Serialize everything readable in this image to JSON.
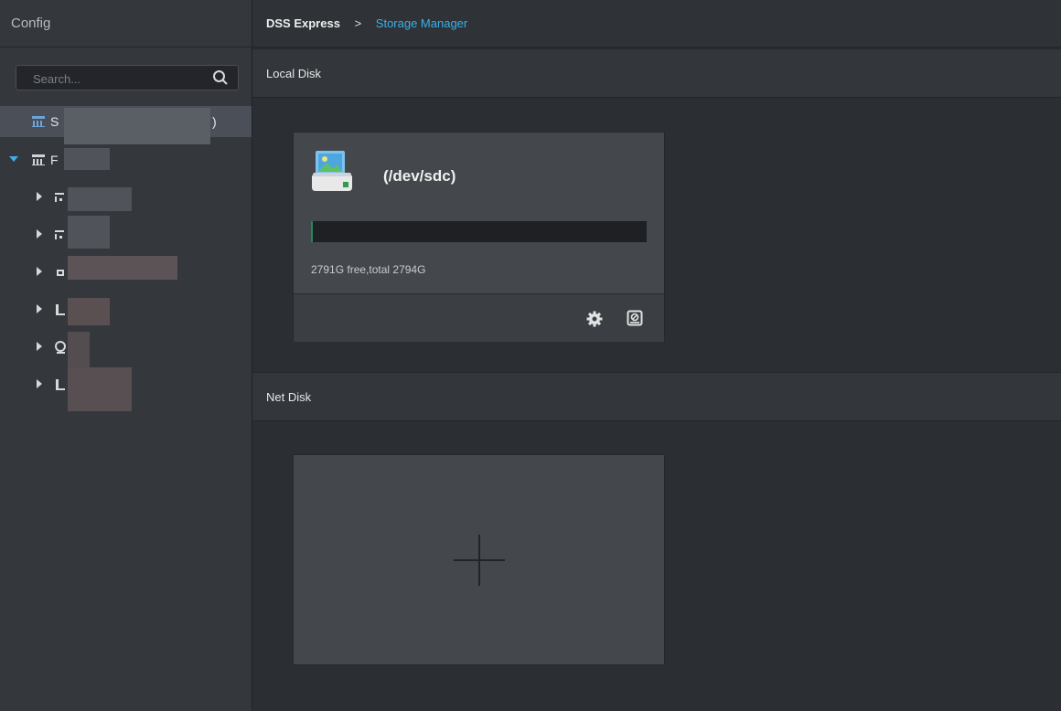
{
  "sidebar": {
    "title": "Config",
    "search_placeholder": "Search...",
    "tree": [
      {
        "label": "S",
        "suffix": ")",
        "selected": true,
        "icon": "server-icon"
      },
      {
        "label": "F",
        "expanded": true,
        "icon": "server-icon"
      },
      {
        "label": "",
        "icon": "network-icon"
      },
      {
        "label": "",
        "icon": "network-icon"
      },
      {
        "label": "",
        "icon": "device-icon"
      },
      {
        "label": "",
        "icon": "monitor-icon"
      },
      {
        "label": "",
        "icon": "camera-icon"
      },
      {
        "label": "",
        "icon": "monitor-icon"
      }
    ]
  },
  "breadcrumb": {
    "home": "DSS Express",
    "separator": ">",
    "current": "Storage Manager"
  },
  "local_disk": {
    "header": "Local Disk",
    "disk": {
      "name": "(/dev/sdc)",
      "free_text": "2791G free,total 2794G",
      "used_fraction": 0.001,
      "bar_color": "#1f8a5b",
      "icon": "hard-disk-icon"
    }
  },
  "net_disk": {
    "header": "Net Disk",
    "add_icon": "plus-icon"
  },
  "colors": {
    "accent": "#3ab0ea",
    "background": "#2b2e33",
    "card": "#44474c"
  }
}
